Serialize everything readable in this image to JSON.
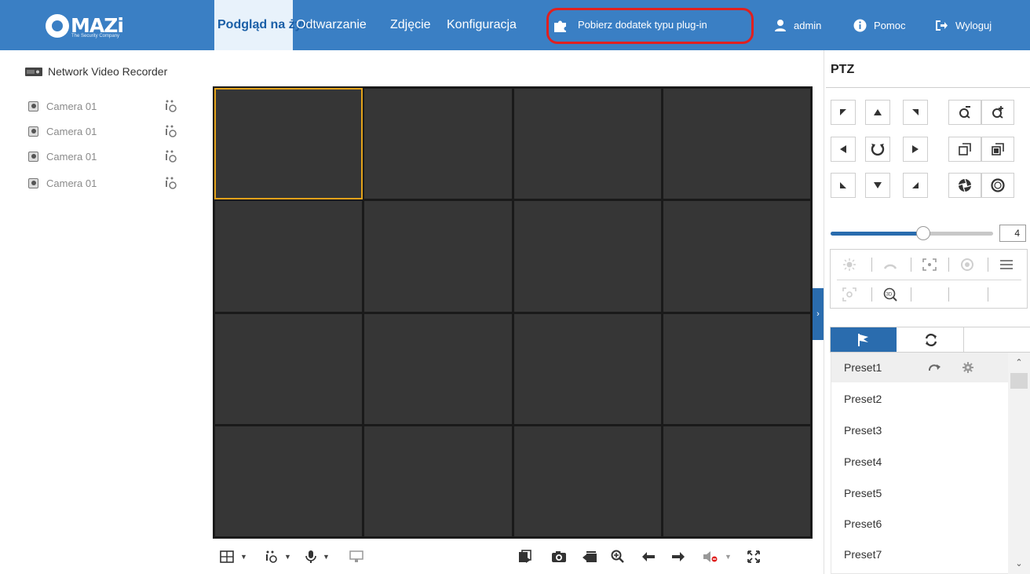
{
  "brand": {
    "name": "MAZi",
    "tagline": "The Security Company",
    "color": "#3a7fc4"
  },
  "nav": {
    "items": [
      {
        "label": "Podgląd na żywo"
      },
      {
        "label": "Odtwarzanie"
      },
      {
        "label": "Zdjęcie"
      },
      {
        "label": "Konfiguracja"
      }
    ],
    "plugin": "Pobierz dodatek typu plug-in",
    "user": "admin",
    "help": "Pomoc",
    "logout": "Wyloguj",
    "highlight_color": "#e0201f"
  },
  "device_tree": {
    "root": "Network Video Recorder",
    "cameras": [
      "Camera 01",
      "Camera 01",
      "Camera 01",
      "Camera 01"
    ]
  },
  "grid": {
    "layout": "4x4",
    "selected_window": 1,
    "selection_color": "#e3a21a"
  },
  "toolbar": {
    "left": [
      "layout-icon",
      "stream-icon",
      "microphone-icon",
      "transcode-icon"
    ],
    "right": [
      "stop-all-icon",
      "snapshot-icon",
      "record-icon",
      "digital-zoom-icon",
      "prev-page-icon",
      "next-page-icon",
      "volume-icon",
      "fullscreen-icon"
    ]
  },
  "ptz": {
    "title": "PTZ",
    "speed": "4",
    "speed_fraction": 0.57,
    "tabs": [
      "preset-flag-icon",
      "patrol-icon",
      ""
    ],
    "presets": [
      "Preset1",
      "Preset2",
      "Preset3",
      "Preset4",
      "Preset5",
      "Preset6",
      "Preset7"
    ]
  }
}
